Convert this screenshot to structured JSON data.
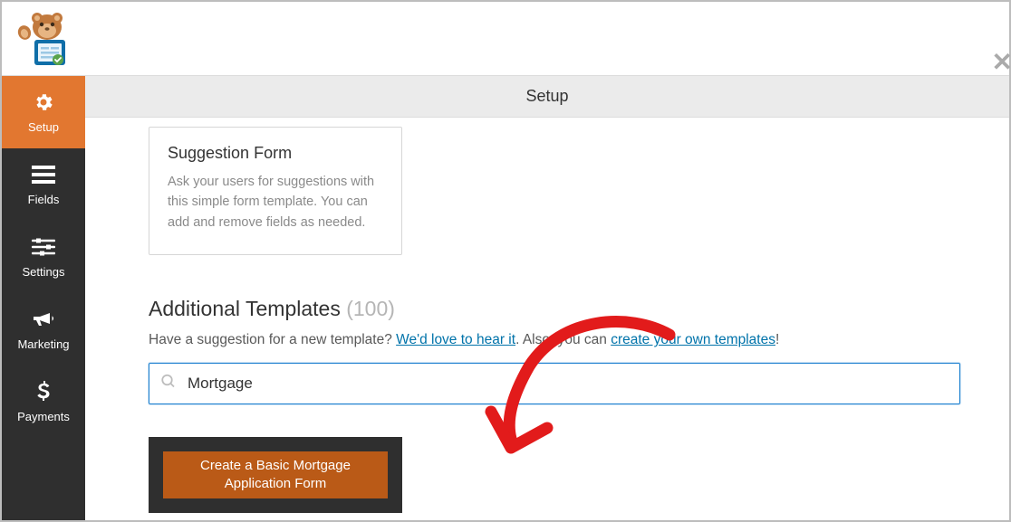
{
  "header": {
    "page_title": "Setup"
  },
  "sidebar": {
    "items": [
      {
        "key": "setup",
        "label": "Setup",
        "active": true
      },
      {
        "key": "fields",
        "label": "Fields",
        "active": false
      },
      {
        "key": "settings",
        "label": "Settings",
        "active": false
      },
      {
        "key": "marketing",
        "label": "Marketing",
        "active": false
      },
      {
        "key": "payments",
        "label": "Payments",
        "active": false
      }
    ]
  },
  "templates": {
    "suggestion_card": {
      "title": "Suggestion Form",
      "desc": "Ask your users for suggestions with this simple form template. You can add and remove fields as needed."
    },
    "additional": {
      "heading": "Additional Templates",
      "count": "(100)",
      "subtext_prefix": "Have a suggestion for a new template? ",
      "link1": "We'd love to hear it",
      "subtext_middle": ". Also, you can ",
      "link2": "create your own templates",
      "subtext_suffix": "!"
    },
    "search": {
      "value": "Mortgage",
      "placeholder": ""
    },
    "result_button": "Create a Basic Mortgage Application Form"
  }
}
